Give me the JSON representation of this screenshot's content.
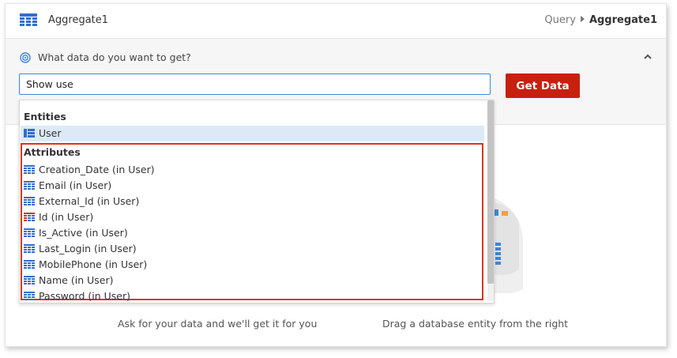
{
  "header": {
    "title": "Aggregate1",
    "icon": "grid-table-icon",
    "breadcrumb": {
      "parent": "Query",
      "current": "Aggregate1"
    }
  },
  "query": {
    "prompt": "What data do you want to get?",
    "input_value": "Show use",
    "get_data_label": "Get Data"
  },
  "colors": {
    "accent": "#3d86d9",
    "button": "#c8200f",
    "highlight_box": "#d8361d",
    "selected_row": "#dde9f7"
  },
  "dropdown": {
    "entities_label": "Entities",
    "entities": [
      {
        "label": "User",
        "icon": "entity-icon"
      }
    ],
    "attributes_label": "Attributes",
    "attributes": [
      {
        "label": "Creation_Date (in User)",
        "icon": "attribute-icon"
      },
      {
        "label": "Email (in User)",
        "icon": "attribute-icon"
      },
      {
        "label": "External_Id (in User)",
        "icon": "attribute-icon"
      },
      {
        "label": "Id (in User)",
        "icon": "key-attribute-icon"
      },
      {
        "label": "Is_Active (in User)",
        "icon": "attribute-icon"
      },
      {
        "label": "Last_Login (in User)",
        "icon": "attribute-icon"
      },
      {
        "label": "MobilePhone (in User)",
        "icon": "attribute-icon"
      },
      {
        "label": "Name (in User)",
        "icon": "attribute-icon"
      },
      {
        "label": "Password (in User)",
        "icon": "attribute-icon"
      }
    ]
  },
  "empty_state": {
    "left_hint": "Ask for your data and we'll get it for you",
    "right_hint": "Drag a database entity from the right"
  }
}
